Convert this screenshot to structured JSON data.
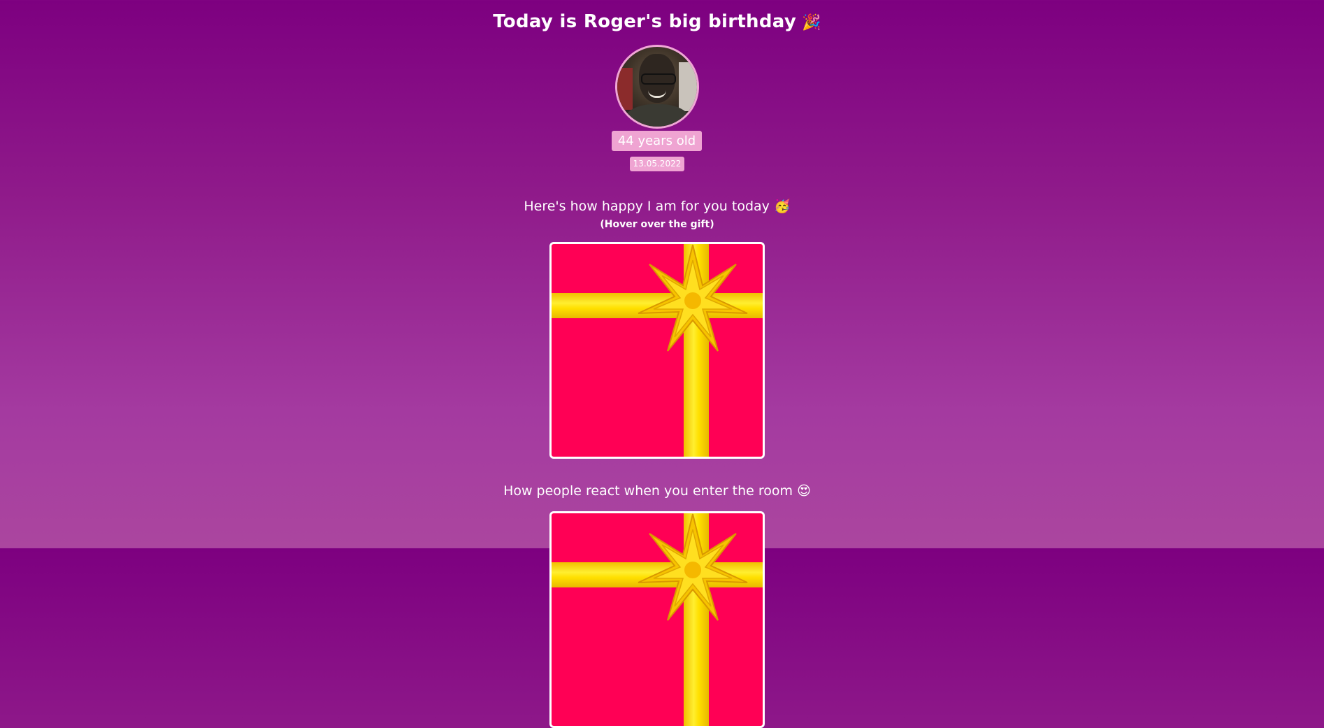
{
  "header": {
    "title": "Today is Roger's big birthday",
    "title_emoji": "🎉"
  },
  "profile": {
    "avatar_icon": "profile-photo",
    "age_label": "44 years old",
    "date": "13.05.2022"
  },
  "gift_section": {
    "heading": "Here's how happy I am for you today",
    "heading_emoji": "🥳",
    "hint": "(Hover over the gift)"
  },
  "reaction_section": {
    "heading": "How people react when you enter the room",
    "heading_emoji": "😍"
  },
  "colors": {
    "background_top": "#7d0080",
    "background_bottom": "#ab469f",
    "badge": "#efa4d2",
    "gift_box": "#ff0055",
    "ribbon": "#ffe000"
  }
}
